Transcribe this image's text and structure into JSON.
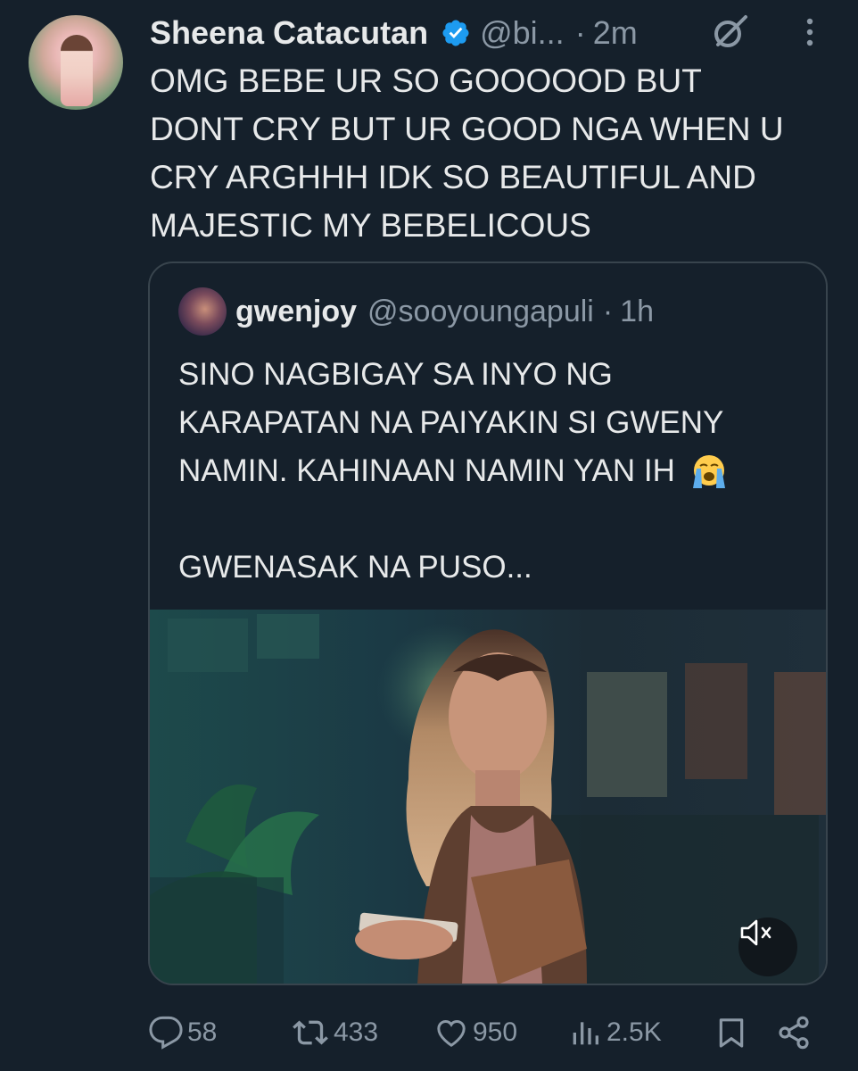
{
  "tweet": {
    "author_name": "Sheena Catacutan",
    "handle": "@bi...",
    "separator": "·",
    "time": "2m",
    "text": "OMG BEBE UR SO GOOOOOD BUT\nDONT CRY BUT UR GOOD NGA WHEN U\nCRY ARGHHH IDK SO BEAUTIFUL AND\nMAJESTIC MY BEBELICOUS",
    "verified": true,
    "icons": [
      "verified-badge-icon",
      "grok-icon",
      "more-options-icon"
    ]
  },
  "quoted_tweet": {
    "author_name": "gwenjoy",
    "handle": "@sooyoungapuli",
    "separator": "·",
    "time": "1h",
    "text": "SINO NAGBIGAY SA INYO NG\nKARAPATAN NA PAIYAKIN SI GWENY\nNAMIN. KAHINAAN NAMIN YAN IH ",
    "text_after": "\n\nGWENASAK NA PUSO...",
    "emoji": "loudly-crying-face",
    "media": {
      "type": "video",
      "muted": true
    }
  },
  "actions": {
    "replies": "58",
    "reposts": "433",
    "likes": "950",
    "views": "2.5K"
  },
  "colors": {
    "background": "#15202b",
    "text": "#e7e9ea",
    "secondary": "#8b98a5",
    "verified": "#1d9bf0",
    "border": "#38444d"
  }
}
